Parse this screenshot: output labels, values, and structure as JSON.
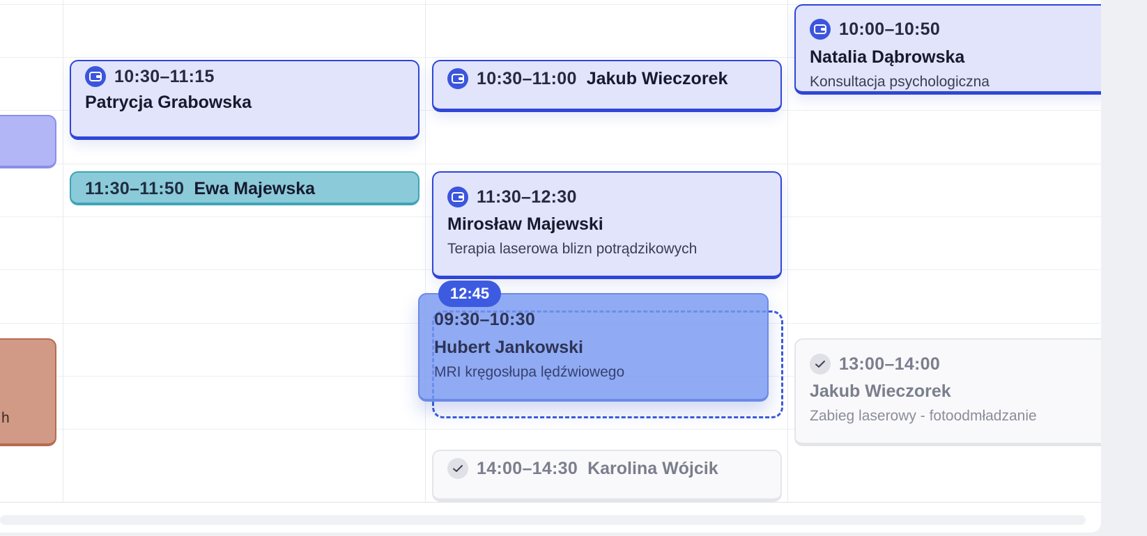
{
  "events": {
    "patrycja": {
      "time": "10:30–11:15",
      "name": "Patrycja Grabowska"
    },
    "ewa": {
      "time": "11:30–11:50",
      "name": "Ewa Majewska"
    },
    "jakub_1030": {
      "time": "10:30–11:00",
      "name": "Jakub Wieczorek"
    },
    "miroslaw": {
      "time": "11:30–12:30",
      "name": "Mirosław Majewski",
      "service": "Terapia laserowa blizn potrądzikowych"
    },
    "hubert": {
      "time": "09:30–10:30",
      "name": "Hubert Jankowski",
      "service": "MRI kręgosłupa lędźwiowego"
    },
    "karolina": {
      "time": "14:00–14:30",
      "name": "Karolina Wójcik"
    },
    "natalia": {
      "time": "10:00–10:50",
      "name": "Natalia Dąbrowska",
      "service": "Konsultacja psychologiczna"
    },
    "jakub_1300": {
      "time": "13:00–14:00",
      "name": "Jakub Wieczorek",
      "service": "Zabieg laserowy - fotoodmładzanie"
    },
    "terracotta_partial": {
      "text": "h"
    }
  },
  "drag": {
    "time_badge": "12:45"
  },
  "icons": {
    "paid": "wallet-icon",
    "completed": "check-icon"
  },
  "colors": {
    "accent": "#3b55dc",
    "event_blue_bg": "#e1e4fb",
    "event_teal_bg": "#8bcad9",
    "event_purple_bg": "#b2b6f7",
    "event_terracotta_bg": "#d09a86",
    "event_done_bg": "#f9f9fb",
    "drag_bg": "#7899f0"
  }
}
